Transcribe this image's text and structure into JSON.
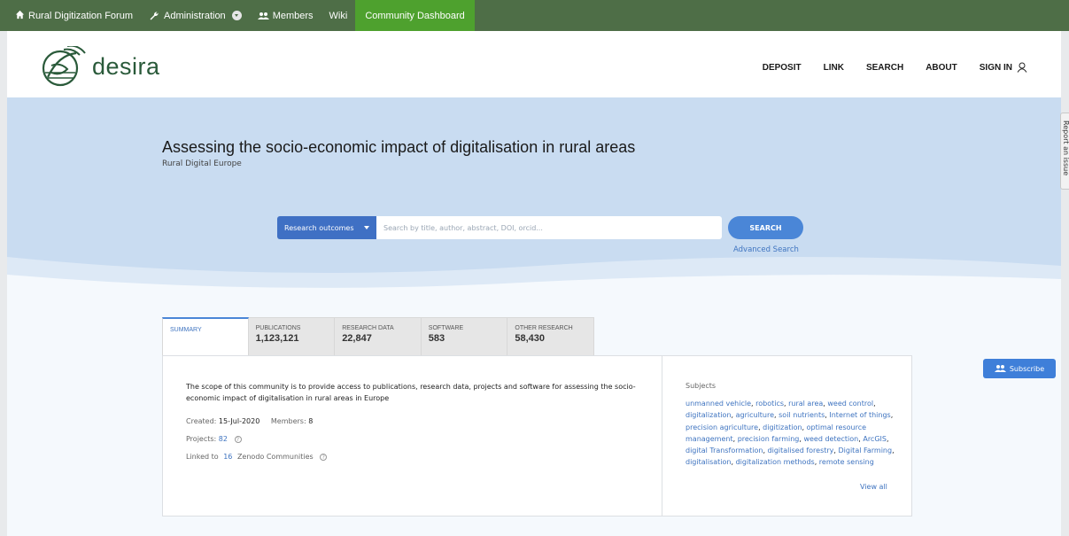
{
  "topbar": {
    "items": [
      {
        "label": "Rural Digitization Forum",
        "icon": "home-icon"
      },
      {
        "label": "Administration",
        "icon": "wrench-icon"
      },
      {
        "label": "Members",
        "icon": "people-icon"
      },
      {
        "label": "Wiki"
      },
      {
        "label": "Community Dashboard",
        "active": true
      }
    ],
    "colors": {
      "bar": "#4e6e47",
      "active": "#4ea12e"
    }
  },
  "header": {
    "logo_text": "Desira",
    "nav": [
      "DEPOSIT",
      "LINK",
      "SEARCH",
      "ABOUT",
      "SIGN IN"
    ]
  },
  "hero": {
    "title": "Assessing the socio-economic impact of digitalisation in rural areas",
    "subtitle": "Rural Digital Europe",
    "search": {
      "select_value": "Research outcomes",
      "placeholder": "Search by title, author, abstract, DOI, orcid...",
      "button_label": "SEARCH",
      "advanced_label": "Advanced Search"
    }
  },
  "side": {
    "report_label": "Report an issue",
    "subscribe_label": "Subscribe"
  },
  "tabs": [
    {
      "label": "SUMMARY",
      "count": ""
    },
    {
      "label": "PUBLICATIONS",
      "count": "1,123,121"
    },
    {
      "label": "RESEARCH DATA",
      "count": "22,847"
    },
    {
      "label": "SOFTWARE",
      "count": "583"
    },
    {
      "label": "OTHER RESEARCH",
      "count": "58,430"
    }
  ],
  "summary": {
    "description": "The scope of this community is to provide access to publications, research data, projects and software for assessing the socio-economic impact of digitalisation in rural areas in Europe",
    "created_label": "Created:",
    "created_value": "15-Jul-2020",
    "members_label": "Members:",
    "members_value": "8",
    "projects_label": "Projects:",
    "projects_value": "82",
    "linked_prefix": "Linked to",
    "linked_value": "16",
    "linked_suffix": "Zenodo Communities",
    "subjects_title": "Subjects",
    "subjects": [
      "unmanned vehicle",
      "robotics",
      "rural area",
      "weed control",
      "digitalization",
      "agriculture",
      "soil nutrients",
      "Internet of things",
      "precision agriculture",
      "digitization",
      "optimal resource management",
      "precision farming",
      "weed detection",
      "ArcGIS",
      "digital Transformation",
      "digitalised forestry",
      "Digital Farming",
      "digitalisation",
      "digitalization methods",
      "remote sensing"
    ],
    "view_all_label": "View all"
  }
}
